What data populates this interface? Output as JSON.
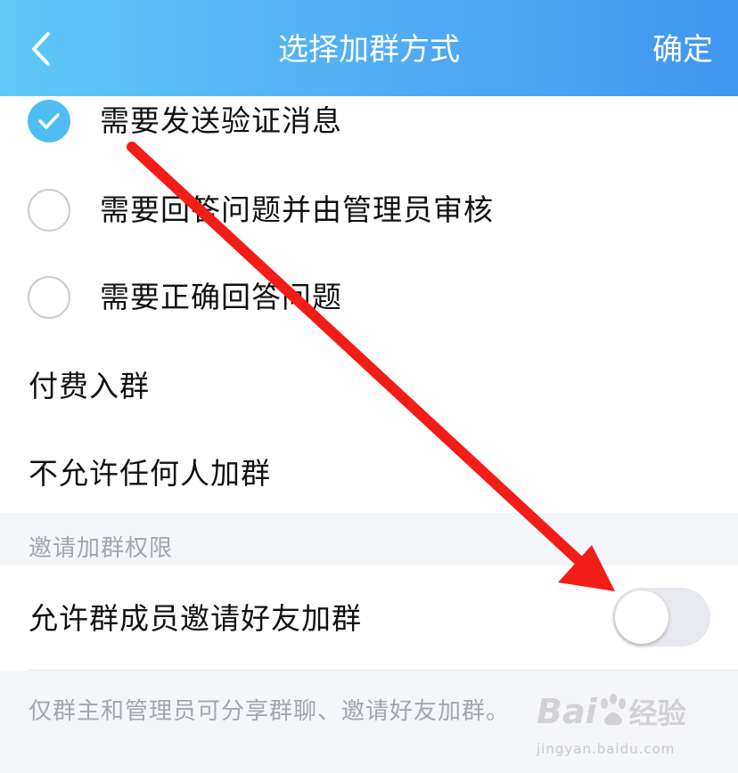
{
  "header": {
    "title": "选择加群方式",
    "confirm_label": "确定"
  },
  "options": [
    {
      "label": "需要发送验证消息",
      "selected": true
    },
    {
      "label": "需要回答问题并由管理员审核",
      "selected": false
    },
    {
      "label": "需要正确回答问题",
      "selected": false
    }
  ],
  "plain_rows": [
    {
      "label": "付费入群"
    },
    {
      "label": "不允许任何人加群"
    }
  ],
  "invite_section": {
    "title": "邀请加群权限",
    "toggle_label": "允许群成员邀请好友加群",
    "toggle_on": false,
    "note": "仅群主和管理员可分享群聊、邀请好友加群。"
  },
  "watermark": {
    "brand_left": "Bai",
    "brand_right": "经验",
    "url": "jingyan.baidu.com"
  },
  "colors": {
    "header_start": "#5ec8f6",
    "header_end": "#3f96f0",
    "check_blue": "#4fbcf2",
    "arrow_red": "#f11d16"
  }
}
